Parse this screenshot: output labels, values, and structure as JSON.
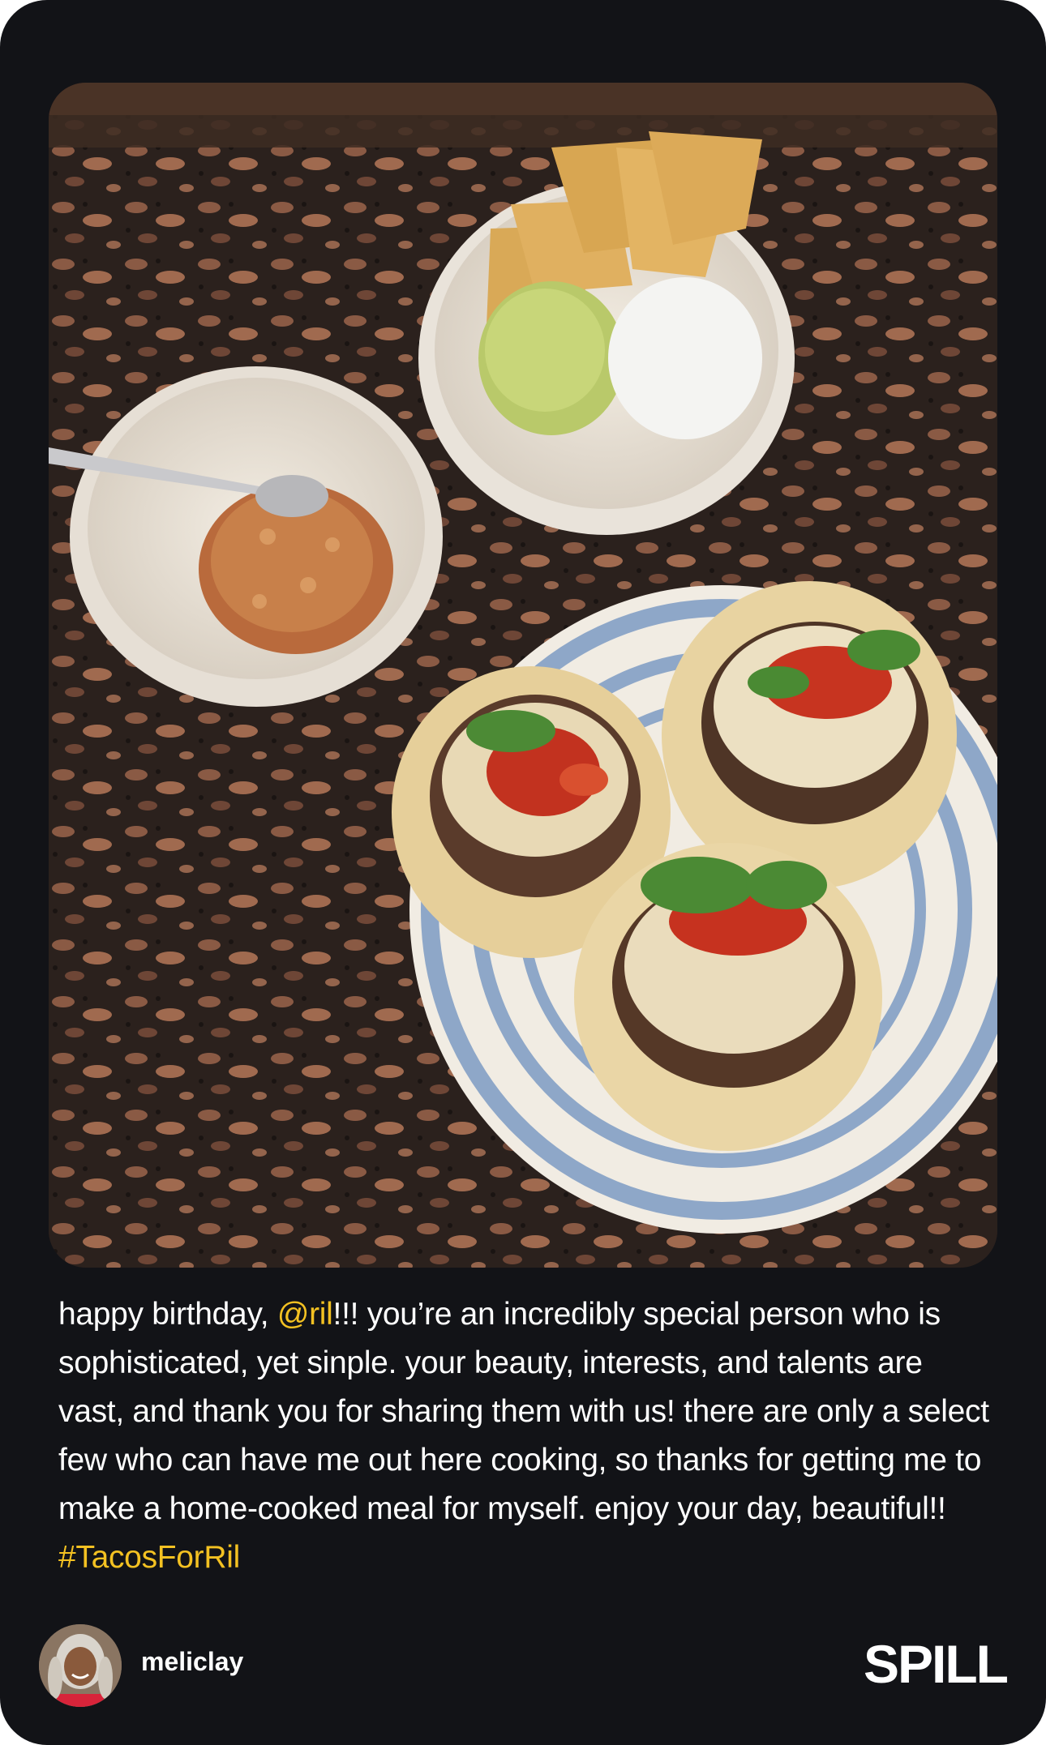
{
  "post": {
    "caption": {
      "part1": "happy birthday, ",
      "mention": "@ril",
      "part2": "!!! you’re an incredibly special person who is sophisticated, yet sinple. your beauty, interests, and talents are vast, and thank you for sharing them with us! there are only a select few who can have me out here cooking, so thanks for getting me to make a home-cooked meal for myself. enjoy your day, beautiful!! ",
      "hashtag": "#TacosForRil"
    },
    "author": {
      "username": "meliclay"
    }
  },
  "brand": {
    "logo_text": "SPILL"
  },
  "colors": {
    "background": "#121317",
    "text": "#ffffff",
    "accent": "#f3c122"
  },
  "icons": {
    "avatar": "user-avatar"
  }
}
